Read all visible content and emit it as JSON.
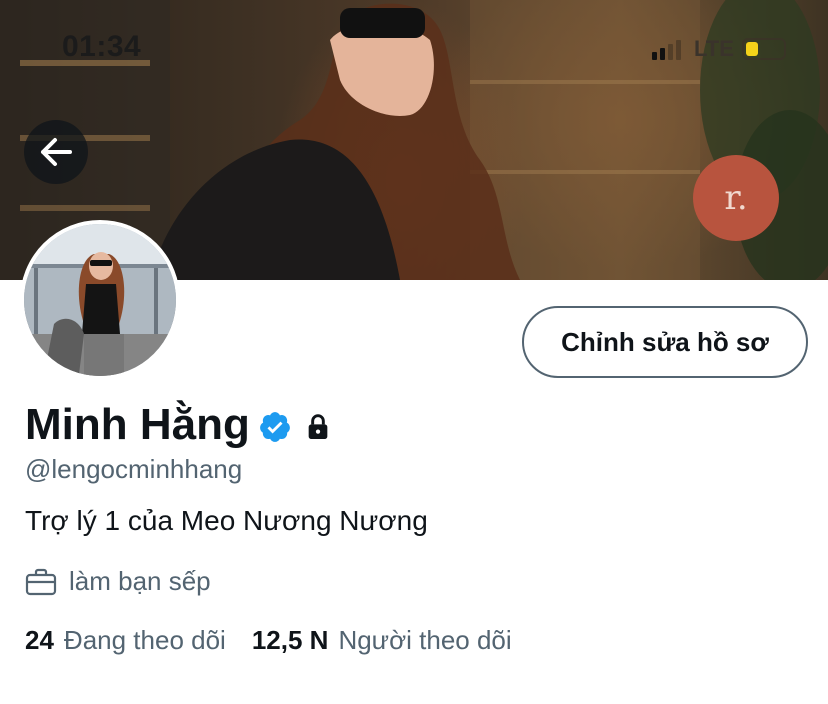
{
  "status_bar": {
    "time": "01:34",
    "network": "LTE"
  },
  "header": {
    "back_icon": "arrow-left-icon"
  },
  "profile": {
    "edit_button_label": "Chỉnh sửa hồ sơ",
    "display_name": "Minh Hằng",
    "handle": "@lengocminhhang",
    "bio": "Trợ lý 1 của Meo Nương Nương",
    "job": "làm bạn sếp",
    "verified": true,
    "protected": true,
    "banner_sign": "r."
  },
  "stats": {
    "following_count": "24",
    "following_label": "Đang theo dõi",
    "followers_count": "12,5 N",
    "followers_label": "Người theo dõi"
  },
  "colors": {
    "verified_blue": "#1d9bf0",
    "secondary_text": "#536471",
    "primary_text": "#0f1419",
    "battery_yellow": "#f5d21a"
  }
}
